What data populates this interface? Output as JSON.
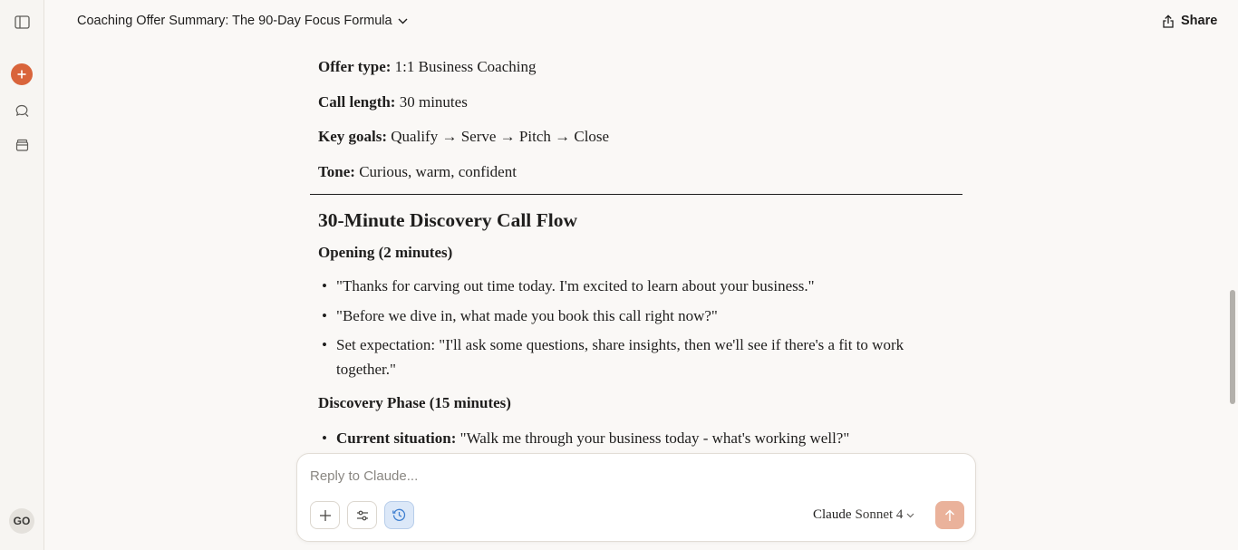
{
  "header": {
    "title": "Coaching Offer Summary: The 90-Day Focus Formula",
    "share_label": "Share"
  },
  "sidebar": {
    "avatar_initials": "GO",
    "icons": [
      "sidebar-toggle-icon",
      "plus-icon",
      "chat-search-icon",
      "archive-icon"
    ]
  },
  "content": {
    "meta": [
      {
        "label": "Offer type:",
        "value": " 1:1 Business Coaching"
      },
      {
        "label": "Call length:",
        "value": " 30 minutes"
      },
      {
        "label": "Key goals:",
        "value": " Qualify → Serve → Pitch → Close"
      },
      {
        "label": "Tone:",
        "value": " Curious, warm, confident"
      }
    ],
    "section_title": "30-Minute Discovery Call Flow",
    "opening": {
      "heading": "Opening (2 minutes)",
      "bullets": [
        "\"Thanks for carving out time today. I'm excited to learn about your business.\"",
        "\"Before we dive in, what made you book this call right now?\"",
        "Set expectation: \"I'll ask some questions, share insights, then we'll see if there's a fit to work together.\""
      ]
    },
    "discovery": {
      "heading": "Discovery Phase (15 minutes)",
      "bullets": [
        {
          "label": "Current situation:",
          "text": " \"Walk me through your business today - what's working well?\""
        }
      ]
    }
  },
  "composer": {
    "placeholder": "Reply to Claude...",
    "model_brand": "Claude",
    "model_version": "Sonnet 4"
  }
}
